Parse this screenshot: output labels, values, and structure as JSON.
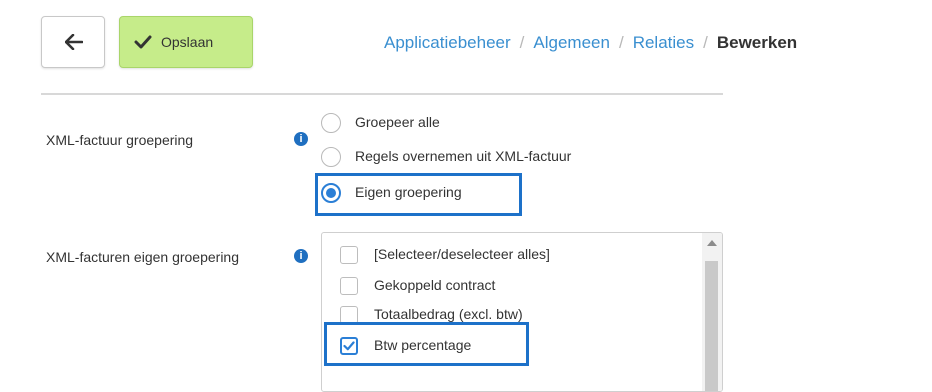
{
  "toolbar": {
    "back_icon": "arrow-left-icon",
    "save_icon": "checkmark-icon",
    "save_label": "Opslaan"
  },
  "breadcrumb": {
    "items": [
      "Applicatiebeheer",
      "Algemeen",
      "Relaties"
    ],
    "separator": "/",
    "current": "Bewerken"
  },
  "form": {
    "grouping": {
      "label": "XML-factuur groepering",
      "info_icon": "info-icon",
      "options": [
        "Groepeer alle",
        "Regels overnemen uit XML-factuur",
        "Eigen groepering"
      ],
      "selected": "Eigen groepering"
    },
    "custom_grouping": {
      "label": "XML-facturen eigen groepering",
      "info_icon": "info-icon",
      "items": [
        {
          "label": "[Selecteer/deselecteer alles]",
          "checked": false
        },
        {
          "label": "Gekoppeld contract",
          "checked": false
        },
        {
          "label": "Totaalbedrag (excl. btw)",
          "checked": false
        },
        {
          "label": "Btw percentage",
          "checked": true
        }
      ]
    }
  },
  "colors": {
    "accent": "#1d71c9",
    "save_button": "#c6ec8a",
    "link": "#3a8fd0"
  }
}
